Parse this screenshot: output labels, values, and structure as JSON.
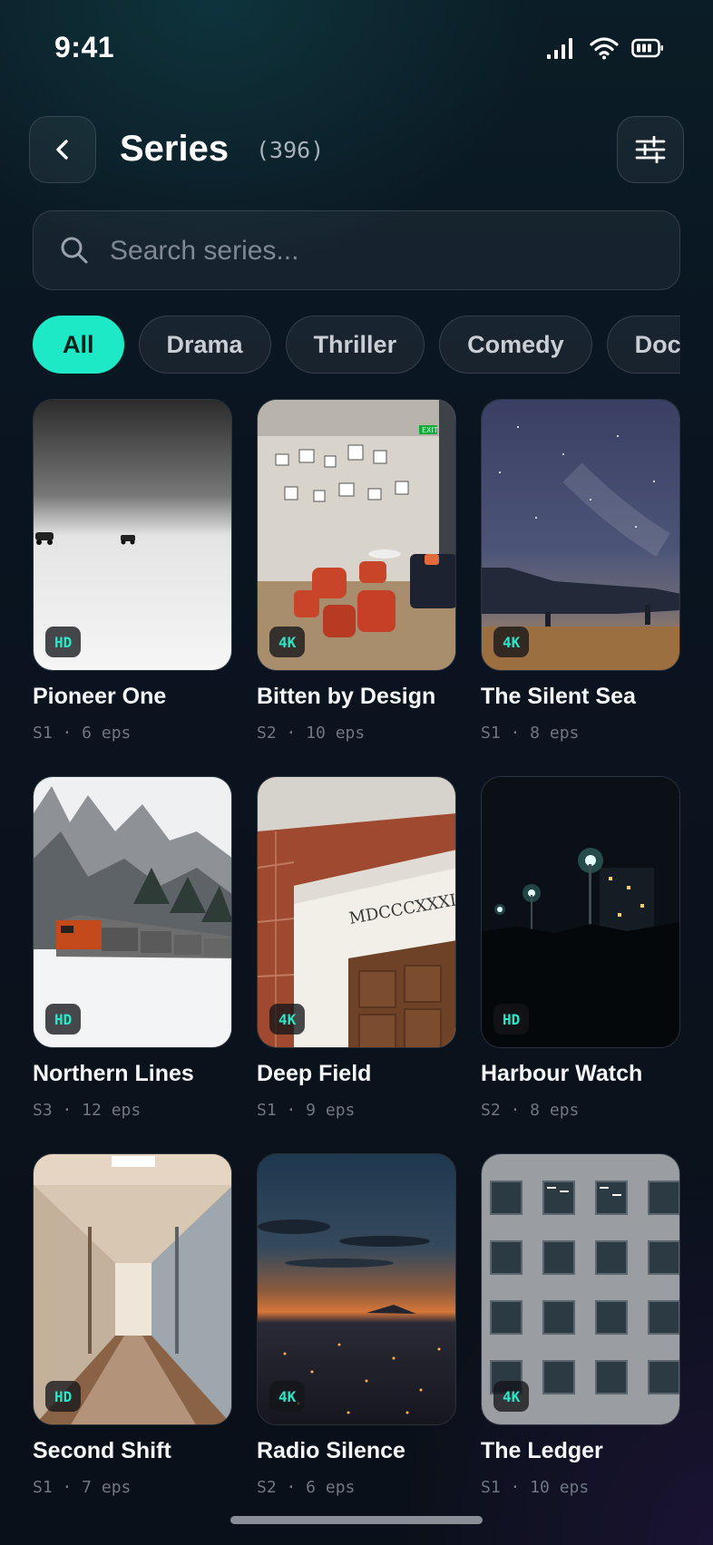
{
  "status_bar": {
    "time": "9:41"
  },
  "header": {
    "title": "Series",
    "count": "(396)"
  },
  "search": {
    "placeholder": "Search series..."
  },
  "chips": [
    "All",
    "Drama",
    "Thriller",
    "Comedy",
    "Docs"
  ],
  "active_chip": "All",
  "accent_color": "#1de9c6",
  "series": [
    {
      "title": "Pioneer One",
      "meta": "S1 · 6 eps",
      "quality": "HD"
    },
    {
      "title": "Bitten by Design",
      "meta": "S2 · 10 eps",
      "quality": "4K"
    },
    {
      "title": "The Silent Sea",
      "meta": "S1 · 8 eps",
      "quality": "4K"
    },
    {
      "title": "Northern Lines",
      "meta": "S3 · 12 eps",
      "quality": "HD"
    },
    {
      "title": "Deep Field",
      "meta": "S1 · 9 eps",
      "quality": "4K"
    },
    {
      "title": "Harbour Watch",
      "meta": "S2 · 8 eps",
      "quality": "HD"
    },
    {
      "title": "Second Shift",
      "meta": "S1 · 7 eps",
      "quality": "HD"
    },
    {
      "title": "Radio Silence",
      "meta": "S2 · 6 eps",
      "quality": "4K"
    },
    {
      "title": "The Ledger",
      "meta": "S1 · 10 eps",
      "quality": "4K"
    }
  ],
  "poster_text": {
    "exit_sign": "EXIT",
    "inscription": "MDCCCXXXI"
  }
}
